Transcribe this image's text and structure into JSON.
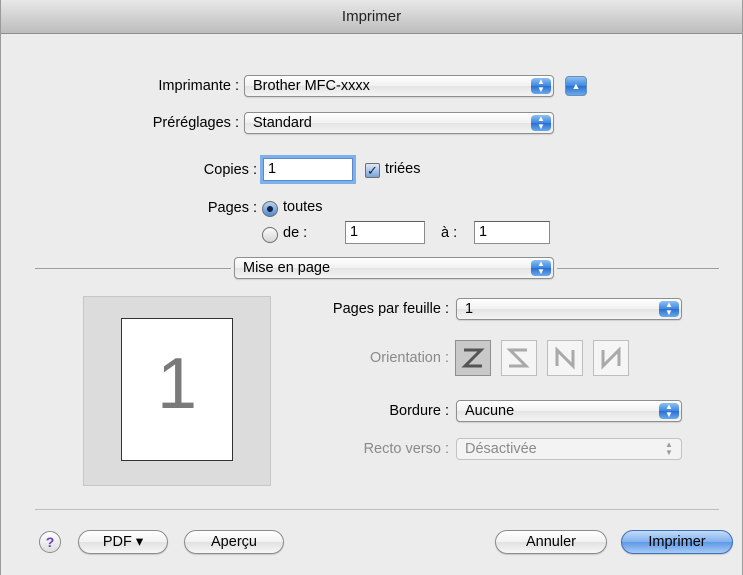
{
  "window": {
    "title": "Imprimer"
  },
  "printer": {
    "label": "Imprimante :",
    "value": "Brother MFC-xxxx",
    "expand_icon": "triangle-up-icon"
  },
  "presets": {
    "label": "Préréglages :",
    "value": "Standard"
  },
  "copies": {
    "label": "Copies :",
    "value": "1",
    "collated_label": "triées",
    "collated_checked": true
  },
  "pages": {
    "label": "Pages :",
    "all_label": "toutes",
    "from_label": "de :",
    "from_value": "1",
    "to_label": "à :",
    "to_value": "1",
    "selected": "all"
  },
  "section": {
    "value": "Mise en page"
  },
  "layout": {
    "preview_number": "1",
    "pages_per_sheet_label": "Pages par feuille :",
    "pages_per_sheet_value": "1",
    "orientation_label": "Orientation :",
    "orientation_icons": [
      "z-order-icon",
      "reverse-z-order-icon",
      "n-order-icon",
      "reverse-n-order-icon"
    ],
    "orientation_selected": 0,
    "border_label": "Bordure :",
    "border_value": "Aucune",
    "duplex_label": "Recto verso :",
    "duplex_value": "Désactivée"
  },
  "buttons": {
    "help": "?",
    "pdf": "PDF ▾",
    "preview": "Aperçu",
    "cancel": "Annuler",
    "print": "Imprimer"
  },
  "colors": {
    "accent": "#3b86e0",
    "focus_ring": "#7fb0ee",
    "help_icon": "#6b3fc0"
  }
}
